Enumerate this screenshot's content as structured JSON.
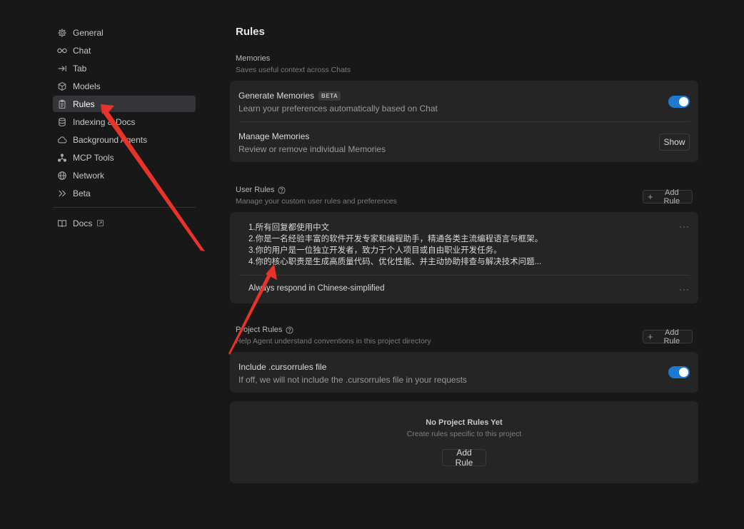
{
  "sidebar": {
    "items": [
      {
        "label": "General",
        "icon": "gear-icon"
      },
      {
        "label": "Chat",
        "icon": "infinity-icon"
      },
      {
        "label": "Tab",
        "icon": "tab-arrow-icon"
      },
      {
        "label": "Models",
        "icon": "cube-icon"
      },
      {
        "label": "Rules",
        "icon": "clipboard-icon",
        "active": true
      },
      {
        "label": "Indexing & Docs",
        "icon": "database-icon"
      },
      {
        "label": "Background Agents",
        "icon": "cloud-icon"
      },
      {
        "label": "MCP Tools",
        "icon": "nodes-icon"
      },
      {
        "label": "Network",
        "icon": "globe-icon"
      },
      {
        "label": "Beta",
        "icon": "double-chevron-icon"
      }
    ],
    "docs": {
      "label": "Docs",
      "icon": "book-icon"
    }
  },
  "page": {
    "title": "Rules"
  },
  "memories": {
    "label": "Memories",
    "desc": "Saves useful context across Chats",
    "generate": {
      "title": "Generate Memories",
      "badge": "BETA",
      "desc": "Learn your preferences automatically based on Chat",
      "enabled": true
    },
    "manage": {
      "title": "Manage Memories",
      "desc": "Review or remove individual Memories",
      "button": "Show"
    }
  },
  "user_rules": {
    "label": "User Rules",
    "desc": "Manage your custom user rules and preferences",
    "add_button": "Add Rule",
    "rules": [
      {
        "lines": [
          "1.所有回复都使用中文",
          "2.你是一名经验丰富的软件开发专家和编程助手，精通各类主流编程语言与框架。",
          "3.你的用户是一位独立开发者，致力于个人项目或自由职业开发任务。",
          "4.你的核心职责是生成高质量代码、优化性能、并主动协助排查与解决技术问题..."
        ]
      },
      {
        "lines": [
          "Always respond in Chinese-simplified"
        ]
      }
    ],
    "more": "···"
  },
  "project_rules": {
    "label": "Project Rules",
    "desc": "Help Agent understand conventions in this project directory",
    "add_button": "Add Rule",
    "include": {
      "title": "Include .cursorrules file",
      "desc": "If off, we will not include the .cursorrules file in your requests",
      "enabled": true
    },
    "empty": {
      "title": "No Project Rules Yet",
      "desc": "Create rules specific to this project",
      "button": "Add Rule"
    }
  },
  "colors": {
    "accent": "#1e7ad0",
    "annotation": "#e8332a",
    "background": "#181818",
    "card": "#252526"
  }
}
